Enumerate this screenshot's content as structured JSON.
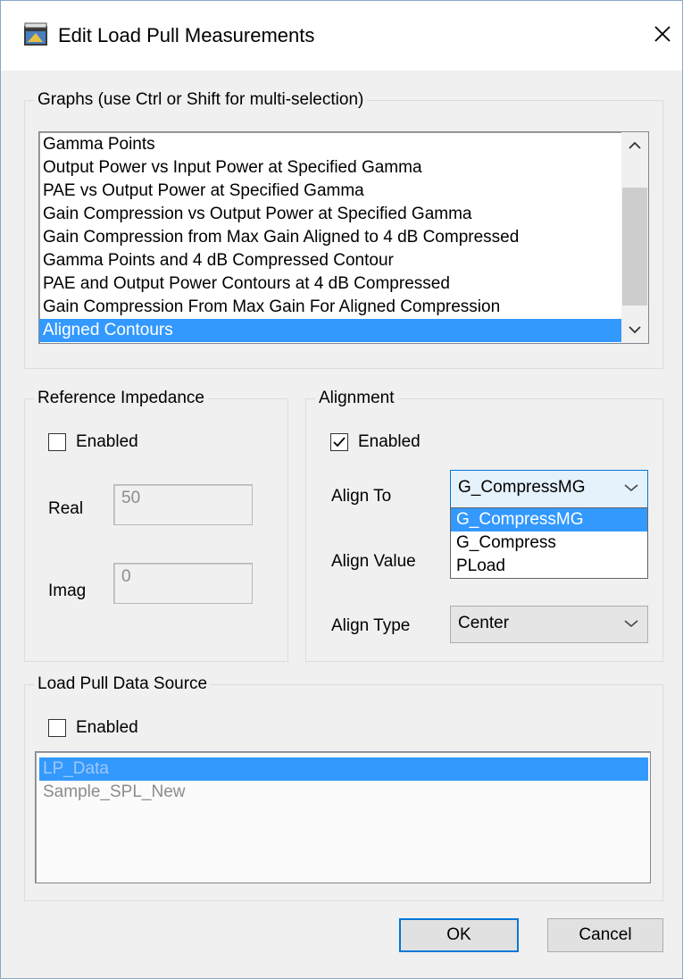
{
  "window": {
    "title": "Edit Load Pull Measurements",
    "app_icon": "awr-app-icon",
    "close_icon": "close-icon"
  },
  "graphs": {
    "legend": "Graphs (use Ctrl or Shift for multi-selection)",
    "items": [
      "Gamma Points",
      "Output Power vs Input Power at Specified Gamma",
      "PAE vs Output Power at Specified Gamma",
      "Gain Compression vs Output Power at Specified Gamma",
      "Gain Compression from Max Gain Aligned to 4 dB Compressed",
      "Gamma Points and 4 dB Compressed Contour",
      "PAE and Output Power Contours at 4 dB Compressed",
      "Gain Compression From Max Gain For Aligned Compression",
      "Aligned Contours"
    ],
    "selected": "Aligned Contours"
  },
  "reference_impedance": {
    "legend": "Reference Impedance",
    "enabled_label": "Enabled",
    "enabled": false,
    "real_label": "Real",
    "real_value": "50",
    "imag_label": "Imag",
    "imag_value": "0"
  },
  "alignment": {
    "legend": "Alignment",
    "enabled_label": "Enabled",
    "enabled": true,
    "align_to_label": "Align To",
    "align_to_value": "G_CompressMG",
    "align_to_options": [
      "G_CompressMG",
      "G_Compress",
      "PLoad"
    ],
    "align_value_label": "Align Value",
    "align_type_label": "Align Type",
    "align_type_value": "Center"
  },
  "data_source": {
    "legend": "Load Pull Data Source",
    "enabled_label": "Enabled",
    "enabled": false,
    "items": [
      "LP_Data",
      "Sample_SPL_New"
    ],
    "selected": "LP_Data"
  },
  "buttons": {
    "ok": "OK",
    "cancel": "Cancel"
  },
  "colors": {
    "selection": "#3399ff",
    "focus_border": "#0078d7",
    "dialog_bg": "#f0f0f0"
  }
}
